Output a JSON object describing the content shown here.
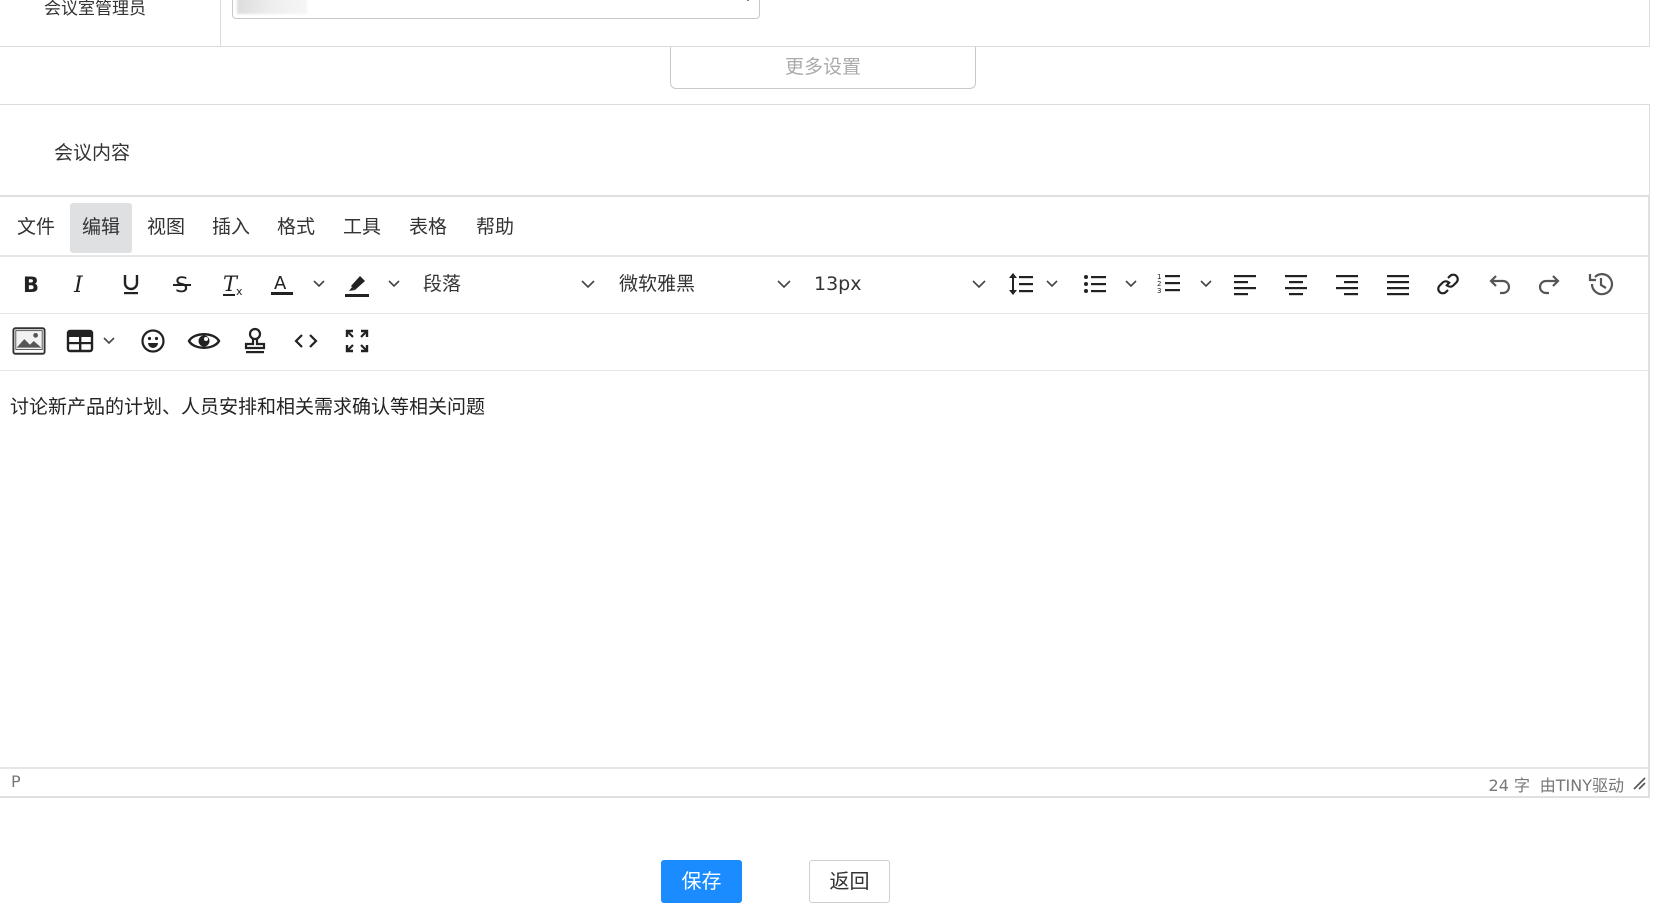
{
  "top_row": {
    "label": "会议室管理员",
    "select_value": ""
  },
  "more_settings": {
    "label": "更多设置"
  },
  "section": {
    "title": "会议内容"
  },
  "editor": {
    "menubar": [
      "文件",
      "编辑",
      "视图",
      "插入",
      "格式",
      "工具",
      "表格",
      "帮助"
    ],
    "active_menu": "编辑",
    "toolbar": {
      "block_format": "段落",
      "font_family": "微软雅黑",
      "font_size": "13px"
    },
    "icons": {
      "row1": [
        "bold-icon",
        "italic-icon",
        "underline-icon",
        "strikethrough-icon",
        "clear-format-icon",
        "text-color-icon",
        "highlight-color-icon",
        "line-height-icon",
        "bullet-list-icon",
        "numbered-list-icon",
        "align-left-icon",
        "align-center-icon",
        "align-right-icon",
        "align-justify-icon",
        "link-icon",
        "undo-icon",
        "redo-icon",
        "history-icon"
      ],
      "row2": [
        "image-icon",
        "table-icon",
        "emoji-icon",
        "preview-icon",
        "stamp-icon",
        "code-icon",
        "fullscreen-icon"
      ]
    },
    "content": "讨论新产品的计划、人员安排和相关需求确认等相关问题",
    "status": {
      "path": "P",
      "word_count": "24 字",
      "brand": "由TINY驱动"
    }
  },
  "actions": {
    "save": "保存",
    "back": "返回"
  },
  "colors": {
    "primary": "#1a8cff",
    "border": "#dcdcdc",
    "active_menu_bg": "#dee0e2",
    "text": "#333333"
  }
}
